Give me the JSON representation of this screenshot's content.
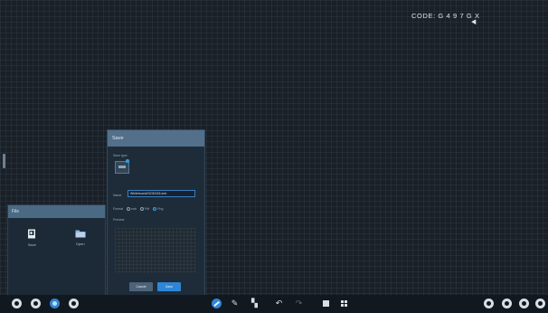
{
  "board": {
    "code_text": "CODE: G 4 9 7 G X"
  },
  "file_panel": {
    "title": "File",
    "actions": [
      {
        "label": "Save",
        "icon": "save-file-icon"
      },
      {
        "label": "Open",
        "icon": "folder-icon"
      }
    ]
  },
  "save_dialog": {
    "title": "Save",
    "save_type_label": "Save type",
    "name_label": "Name",
    "name_value": "Whiteboard20230318.enb",
    "format_label": "Format",
    "formats": [
      "enb",
      "Pdf",
      "Png"
    ],
    "selected_format": "Png",
    "preview_label": "Preview",
    "cancel_label": "Cancel",
    "save_label": "Save"
  },
  "toolbar": {
    "left": [
      "home-icon",
      "settings-icon",
      "file-icon",
      "compass-icon"
    ],
    "center": [
      "pen-icon",
      "highlighter-icon",
      "eraser-icon",
      "undo-icon",
      "redo-icon",
      "page-icon",
      "grid-icon"
    ],
    "right": [
      "menu-icon",
      "theme-icon",
      "share-icon",
      "power-icon"
    ]
  },
  "colors": {
    "accent": "#2f86d6",
    "panel_header": "#52708a",
    "background": "#1a2028"
  }
}
